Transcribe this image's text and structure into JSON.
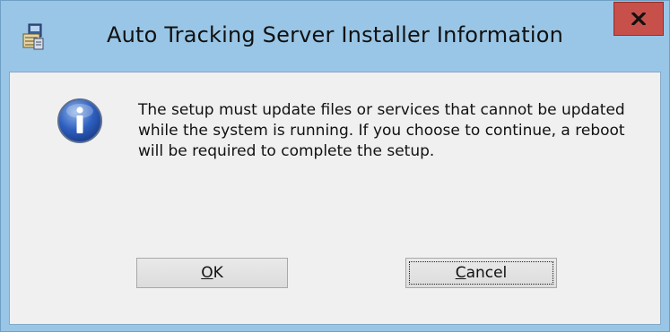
{
  "window": {
    "title": "Auto Tracking Server Installer Information",
    "close_symbol": "x"
  },
  "dialog": {
    "icon": "info-icon",
    "message": "The setup must update files or services that cannot be updated while the system is running. If you choose to continue, a reboot will be required to complete the setup."
  },
  "buttons": {
    "ok": {
      "mnemonic": "O",
      "rest": "K"
    },
    "cancel": {
      "mnemonic": "C",
      "rest": "ancel"
    }
  },
  "colors": {
    "frame": "#99c6e6",
    "close_button": "#c7504b",
    "client_background": "#f0f0f0"
  }
}
